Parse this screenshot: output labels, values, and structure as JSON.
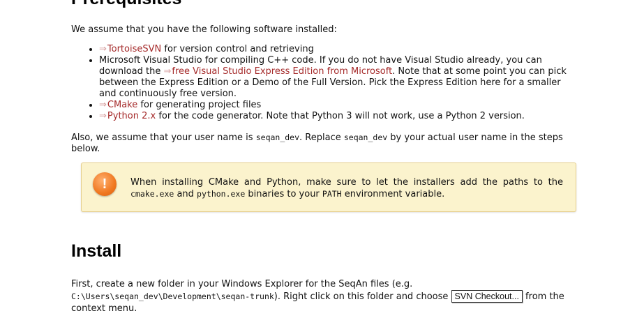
{
  "prerequisites": {
    "heading": "Prerequisites",
    "intro": "We assume that you have the following software installed:",
    "arrow": "⇒",
    "items": [
      {
        "link": "TortoiseSVN",
        "rest": " for version control and retrieving"
      },
      {
        "text1": "Microsoft Visual Studio for compiling C++ code. If you do not have Visual Studio already, you can download the ",
        "link": "free Visual Studio Express Edition from Microsoft",
        "text2": ". Note that at some point you can pick between the Express Edition or a Demo of the Full Version. Pick the Express Edition here for a smaller and continuously free version."
      },
      {
        "link": "CMake",
        "rest": " for generating project files"
      },
      {
        "link": "Python 2.x",
        "rest": " for the code generator. Note that Python 3 will not work, use a Python 2 version."
      }
    ],
    "also_1": "Also, we assume that your user name is ",
    "also_code1": "seqan_dev",
    "also_2": ". Replace ",
    "also_code2": "seqan_dev",
    "also_3": " by your actual user name in the steps below."
  },
  "note": {
    "icon_glyph": "!",
    "t1": "When installing CMake and Python, make sure to let the installers add the paths to the ",
    "c1": "cmake.exe",
    "t2": " and ",
    "c2": "python.exe",
    "t3": " binaries to your ",
    "c3": "PATH",
    "t4": " environment variable."
  },
  "install": {
    "heading": "Install",
    "t1": "First, create a new folder in your Windows Explorer for the SeqAn files (e.g. ",
    "path": "C:\\Users\\seqan_dev\\Development\\seqan-trunk",
    "t2": "). Right click on this folder and choose ",
    "button": "SVN Checkout...",
    "t3": " from the context menu."
  },
  "colors": {
    "link": "#a52a2a",
    "note_bg": "#fbf3cd",
    "note_border": "#e6cf8e",
    "warning_icon": "#f07820"
  }
}
